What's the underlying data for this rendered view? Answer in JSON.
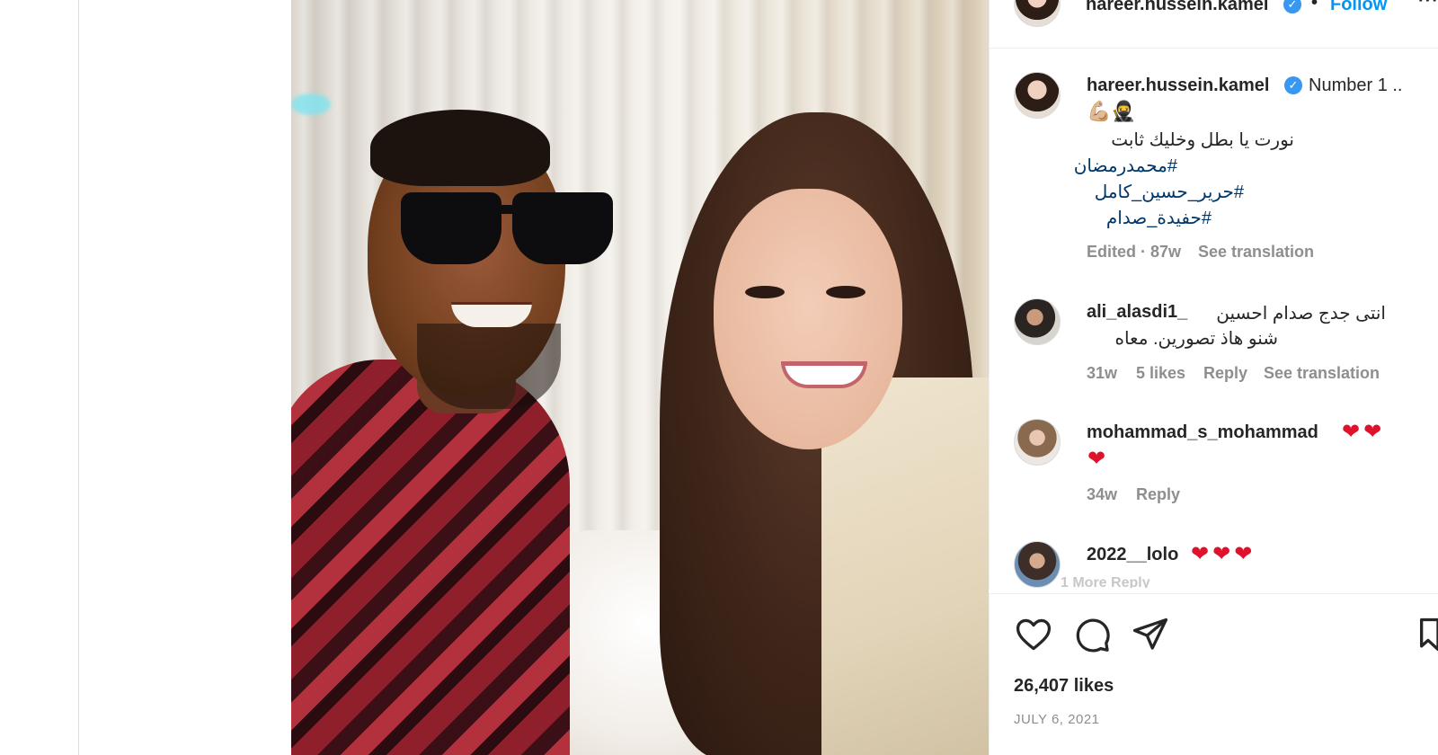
{
  "post": {
    "author": "hareer.hussein.kamel",
    "follow_label": "Follow",
    "separator": "•",
    "more_menu": "···"
  },
  "caption": {
    "author": "hareer.hussein.kamel",
    "first_line": "Number 1 ..",
    "emoji_line": "💪🏼🥷",
    "arabic_line": "نورت يا بطل وخليك ثابت",
    "hashtags": [
      "#محمدرمضان",
      "#حرير_حسين_كامل",
      "#حفيدة_صدام"
    ],
    "edited": "Edited · 87w",
    "see_translation": "See translation"
  },
  "comments": [
    {
      "username": "ali_alasdi1_",
      "lines": [
        "انتى جدج صدام احسين",
        "شنو هاذ تصورين. معاه"
      ],
      "time": "31w",
      "likes": "5 likes",
      "reply": "Reply",
      "see_translation": "See translation"
    },
    {
      "username": "mohammad_s_mohammad",
      "hearts_inline": "❤❤",
      "hearts_next": "❤",
      "time": "34w",
      "reply": "Reply"
    },
    {
      "username": "2022__lolo",
      "hearts_inline": "❤❤❤",
      "cut_line": "1 More Reply"
    }
  ],
  "stats": {
    "likes": "26,407 likes",
    "date": "JULY 6, 2021"
  },
  "icons": [
    "heart-icon",
    "comment-icon",
    "share-icon",
    "bookmark-icon",
    "verified-badge-icon"
  ],
  "colors": {
    "link_blue": "#0095f6",
    "hashtag_blue": "#00376b",
    "meta_gray": "#8e8e8e",
    "heart_red": "#e0112b",
    "verified_blue": "#3897f0"
  }
}
